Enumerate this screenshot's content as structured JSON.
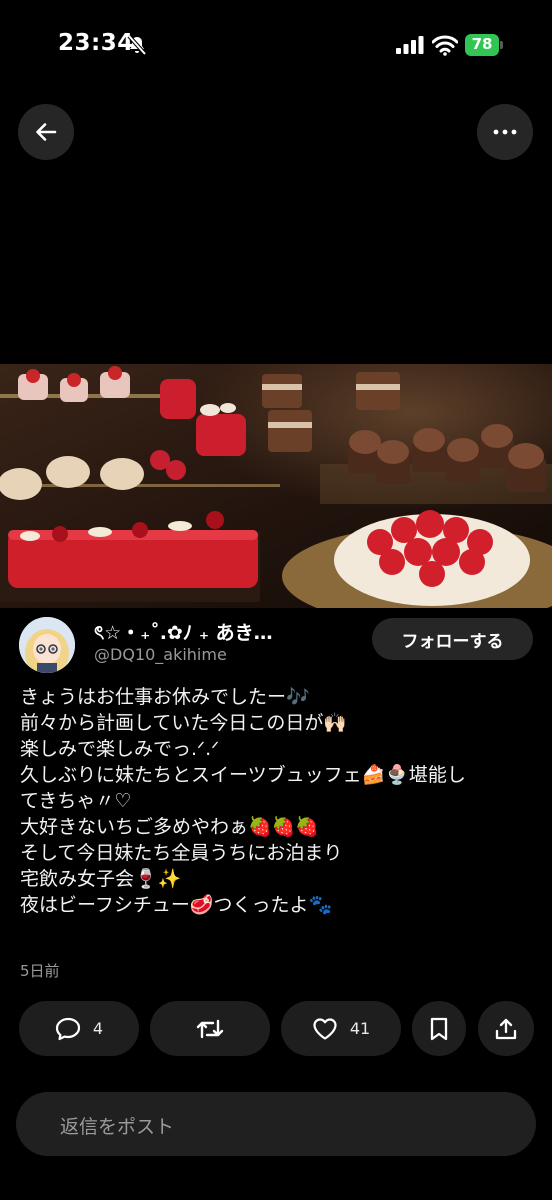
{
  "status_bar": {
    "time": "23:34",
    "battery": "78"
  },
  "post": {
    "display_name": "ৎ☆・₊˚.✿ﾉ ₊ あき…",
    "handle": "@DQ10_akihime",
    "follow_label": "フォローする",
    "lines": [
      "きょうはお仕事お休みでしたー🎶",
      "前々から計画していた今日この日が🙌🏻",
      "楽しみで楽しみでっ.ᐟ.ᐟ",
      "久しぶりに妹たちとスイーツブュッフェ🍰🍨堪能し",
      "てきちゃ〃♡",
      "大好きないちご多めやわぁ🍓🍓🍓",
      "そして今日妹たち全員うちにお泊まり",
      "宅飲み女子会🍷✨",
      "夜はビーフシチュー🥩つくったよ🐾"
    ],
    "timestamp": "5日前"
  },
  "actions": {
    "reply_count": "4",
    "like_count": "41"
  },
  "reply_box": {
    "placeholder": "返信をポスト"
  },
  "icons": {
    "back": "arrow-left-icon",
    "more": "ellipsis-icon",
    "reply": "speech-bubble-icon",
    "repost": "repost-arrows-icon",
    "like": "heart-icon",
    "bookmark": "bookmark-icon",
    "share": "share-upload-icon"
  },
  "colors": {
    "background": "#000000",
    "button_bg": "#262626",
    "secondary_text": "#9a9a9a",
    "battery": "#31c554"
  }
}
